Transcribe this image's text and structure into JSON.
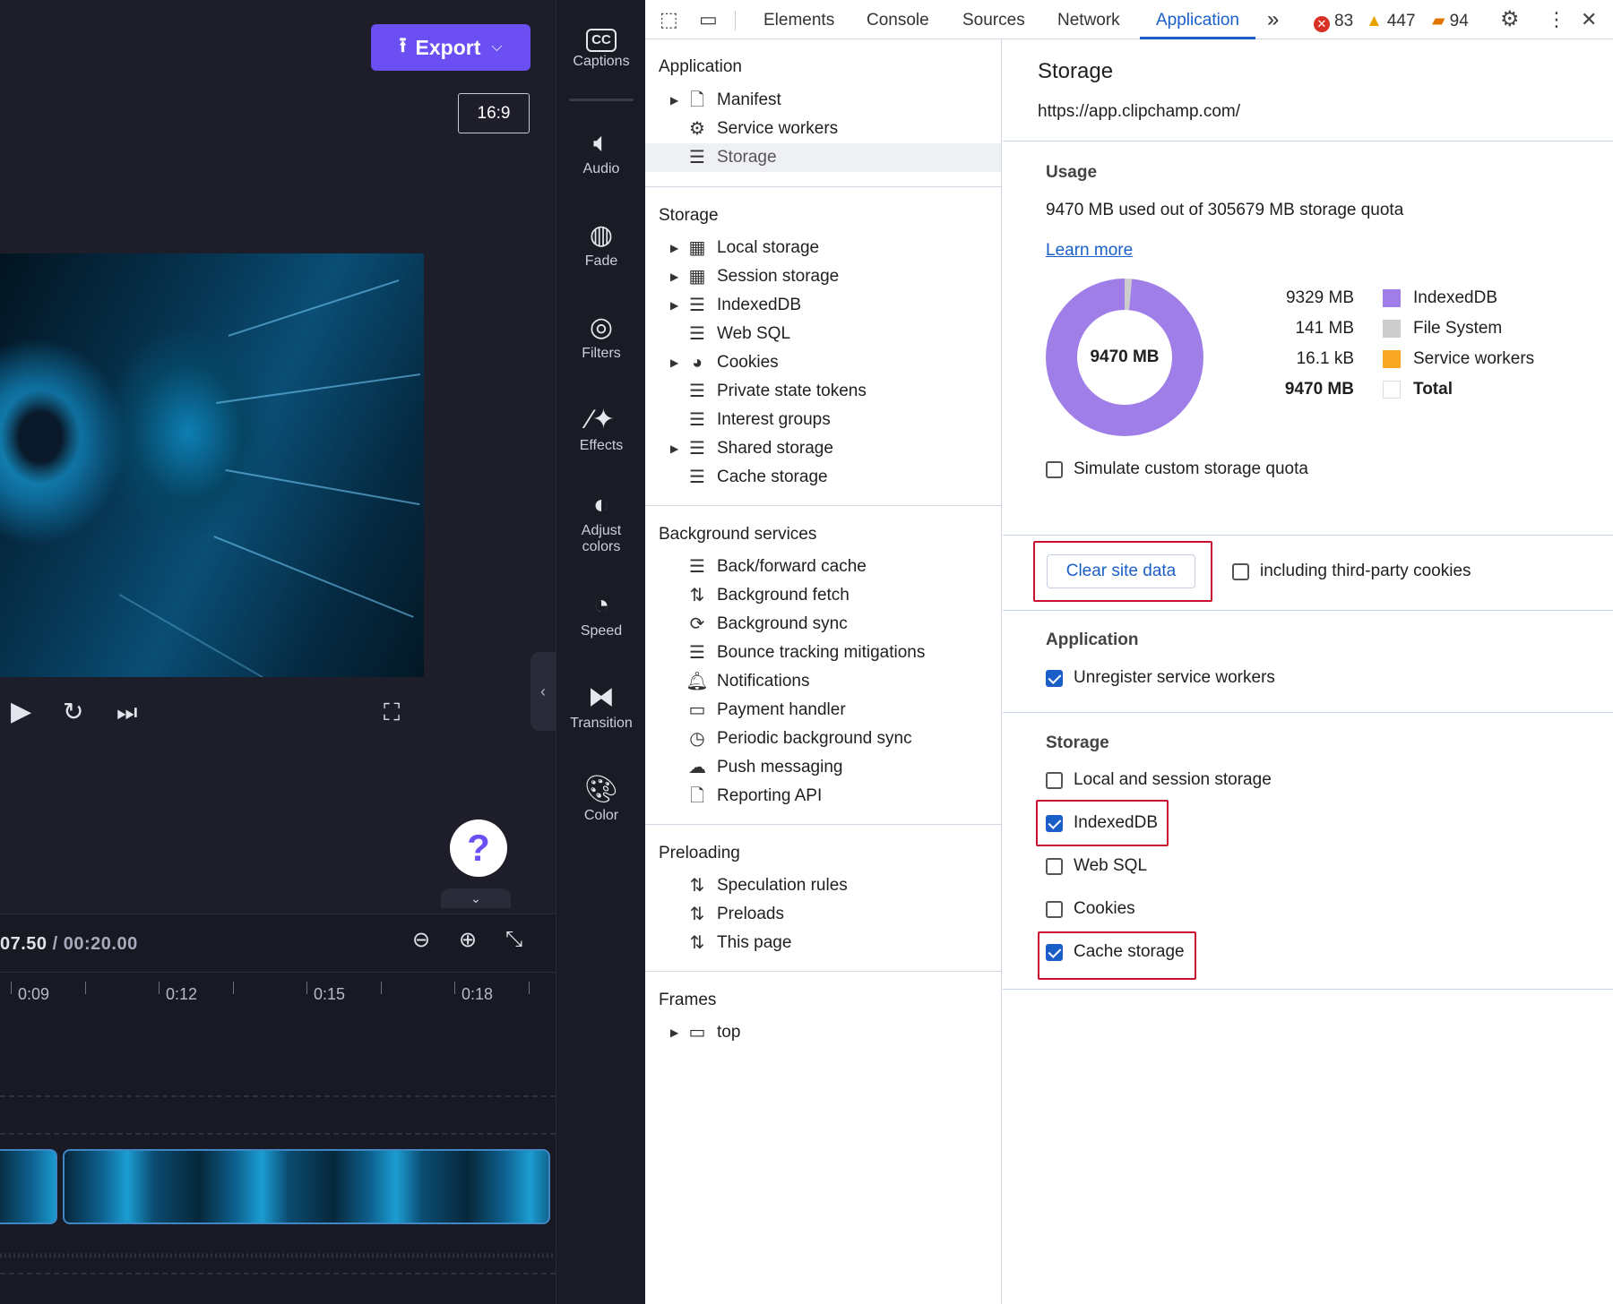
{
  "editor": {
    "export_label": "Export",
    "aspect_ratio": "16:9",
    "help_label": "?",
    "time_current": "07.50",
    "time_separator": "/",
    "time_total": "00:20.00",
    "ruler_ticks": [
      "0:09",
      "0:12",
      "0:15",
      "0:18"
    ],
    "player": {
      "play_icon": "play-icon",
      "replay_icon": "rewind-5-icon",
      "skip_end_icon": "skip-to-end-icon",
      "fullscreen_icon": "fullscreen-icon"
    },
    "timeline_icons": [
      "zoom-out-icon",
      "zoom-in-icon",
      "fit-to-screen-icon"
    ]
  },
  "rail": {
    "items": [
      {
        "label": "Captions",
        "icon": "captions-icon"
      },
      {
        "label": "Audio",
        "icon": "speaker-icon"
      },
      {
        "label": "Fade",
        "icon": "fade-icon"
      },
      {
        "label": "Filters",
        "icon": "filters-icon"
      },
      {
        "label": "Effects",
        "icon": "magic-wand-icon"
      },
      {
        "label": "Adjust colors",
        "icon": "adjust-colors-icon"
      },
      {
        "label": "Speed",
        "icon": "speedometer-icon"
      },
      {
        "label": "Transition",
        "icon": "transition-icon"
      },
      {
        "label": "Color",
        "icon": "palette-icon"
      }
    ]
  },
  "devtools": {
    "tabs": [
      "Elements",
      "Console",
      "Sources",
      "Network",
      "Application"
    ],
    "active_tab": "Application",
    "more_tabs_label": "»",
    "counts": {
      "errors": "83",
      "warnings": "447",
      "issues": "94"
    },
    "colors": {
      "accent": "#1a5fc8",
      "error": "#d93025",
      "warning": "#e8a200",
      "issue": "#e37400",
      "highlight": "#c8102e"
    },
    "nav": {
      "application": {
        "heading": "Application",
        "items": [
          {
            "label": "Manifest",
            "icon": "document-icon",
            "expandable": true
          },
          {
            "label": "Service workers",
            "icon": "gears-icon",
            "expandable": false
          },
          {
            "label": "Storage",
            "icon": "database-icon",
            "expandable": false,
            "selected": true
          }
        ]
      },
      "storage": {
        "heading": "Storage",
        "items": [
          {
            "label": "Local storage",
            "icon": "table-icon",
            "expandable": true
          },
          {
            "label": "Session storage",
            "icon": "table-icon",
            "expandable": true
          },
          {
            "label": "IndexedDB",
            "icon": "database-icon",
            "expandable": true
          },
          {
            "label": "Web SQL",
            "icon": "database-icon",
            "expandable": false
          },
          {
            "label": "Cookies",
            "icon": "cookie-icon",
            "expandable": true
          },
          {
            "label": "Private state tokens",
            "icon": "database-icon",
            "expandable": false
          },
          {
            "label": "Interest groups",
            "icon": "database-icon",
            "expandable": false
          },
          {
            "label": "Shared storage",
            "icon": "database-icon",
            "expandable": true
          },
          {
            "label": "Cache storage",
            "icon": "database-icon",
            "expandable": false
          }
        ]
      },
      "background": {
        "heading": "Background services",
        "items": [
          {
            "label": "Back/forward cache",
            "icon": "database-icon"
          },
          {
            "label": "Background fetch",
            "icon": "up-down-arrows-icon"
          },
          {
            "label": "Background sync",
            "icon": "sync-icon"
          },
          {
            "label": "Bounce tracking mitigations",
            "icon": "database-icon"
          },
          {
            "label": "Notifications",
            "icon": "bell-icon"
          },
          {
            "label": "Payment handler",
            "icon": "credit-card-icon"
          },
          {
            "label": "Periodic background sync",
            "icon": "clock-icon"
          },
          {
            "label": "Push messaging",
            "icon": "cloud-icon"
          },
          {
            "label": "Reporting API",
            "icon": "document-icon"
          }
        ]
      },
      "preloading": {
        "heading": "Preloading",
        "items": [
          {
            "label": "Speculation rules",
            "icon": "up-down-arrows-icon"
          },
          {
            "label": "Preloads",
            "icon": "up-down-arrows-icon"
          },
          {
            "label": "This page",
            "icon": "up-down-arrows-icon"
          }
        ]
      },
      "frames": {
        "heading": "Frames",
        "items": [
          {
            "label": "top",
            "icon": "frame-icon",
            "expandable": true
          }
        ]
      }
    },
    "main": {
      "title": "Storage",
      "origin": "https://app.clipchamp.com/",
      "usage_heading": "Usage",
      "usage_text": "9470 MB used out of 305679 MB storage quota",
      "learn_more": "Learn more",
      "donut_label": "9470 MB",
      "legend": [
        {
          "value": "9329 MB",
          "label": "IndexedDB",
          "color": "#a07ee8"
        },
        {
          "value": "141 MB",
          "label": "File System",
          "color": "#cccccc"
        },
        {
          "value": "16.1 kB",
          "label": "Service workers",
          "color": "#f9a825"
        },
        {
          "value": "9470 MB",
          "label": "Total",
          "color": "#ffffff"
        }
      ],
      "simulate_quota": {
        "label": "Simulate custom storage quota",
        "checked": false
      },
      "clear_button": "Clear site data",
      "third_party": {
        "label": "including third-party cookies",
        "checked": false
      },
      "app_heading": "Application",
      "unregister": {
        "label": "Unregister service workers",
        "checked": true
      },
      "storage_heading": "Storage",
      "storage_options": [
        {
          "label": "Local and session storage",
          "checked": false
        },
        {
          "label": "IndexedDB",
          "checked": true
        },
        {
          "label": "Web SQL",
          "checked": false
        },
        {
          "label": "Cookies",
          "checked": false
        },
        {
          "label": "Cache storage",
          "checked": true
        }
      ]
    }
  }
}
